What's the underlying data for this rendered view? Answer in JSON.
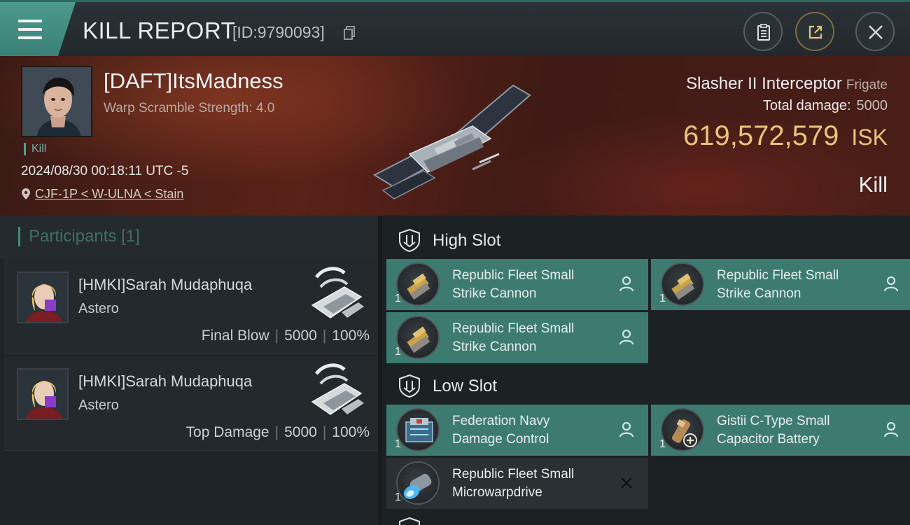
{
  "header": {
    "title": "KILL REPORT",
    "report_id": "[ID:9790093]"
  },
  "victim": {
    "name": "[DAFT]ItsMadness",
    "scramble": "Warp Scramble Strength: 4.0",
    "kill_tag": "Kill",
    "datetime": "2024/08/30 00:18:11 UTC -5",
    "location": "CJF-1P < W-ULNA < Stain",
    "ship_name": "Slasher II Interceptor",
    "ship_class": "Frigate",
    "total_damage_label": "Total damage:",
    "total_damage": "5000",
    "isk_value": "619,572,579",
    "isk_unit": "ISK",
    "result": "Kill"
  },
  "participants": {
    "label": "Participants",
    "count": "[1]",
    "rows": [
      {
        "name": "[HMKI]Sarah Mudaphuqa",
        "ship": "Astero",
        "role": "Final Blow",
        "damage": "5000",
        "percent": "100%"
      },
      {
        "name": "[HMKI]Sarah Mudaphuqa",
        "ship": "Astero",
        "role": "Top Damage",
        "damage": "5000",
        "percent": "100%"
      }
    ]
  },
  "slots": {
    "high": {
      "label": "High Slot",
      "modules": [
        {
          "line1": "Republic Fleet Small",
          "line2": "Strike Cannon",
          "qty": "1"
        },
        {
          "line1": "Republic Fleet Small",
          "line2": "Strike Cannon",
          "qty": "1"
        },
        {
          "line1": "Republic Fleet Small",
          "line2": "Strike Cannon",
          "qty": "1"
        }
      ]
    },
    "low": {
      "label": "Low Slot",
      "modules": [
        {
          "line1": "Federation Navy",
          "line2": "Damage Control",
          "qty": "1"
        },
        {
          "line1": "Gistii C-Type Small",
          "line2": "Capacitor Battery",
          "qty": "1"
        },
        {
          "line1": "Republic Fleet Small",
          "line2": "Microwarpdrive",
          "qty": "1"
        }
      ]
    }
  },
  "colors": {
    "accent": "#3d7b71",
    "isk": "#e9c47a",
    "banner": "#5a2218"
  }
}
